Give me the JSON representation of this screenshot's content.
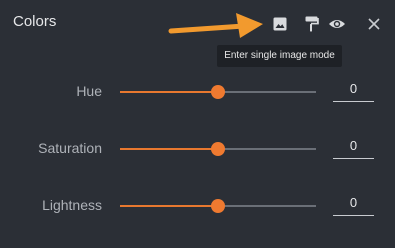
{
  "panel": {
    "title": "Colors",
    "tooltip": "Enter single image mode"
  },
  "toolbar": [
    {
      "name": "image-mode-icon"
    },
    {
      "name": "paint-roller-icon"
    },
    {
      "name": "eye-icon"
    },
    {
      "name": "close-icon"
    }
  ],
  "sliders": [
    {
      "label": "Hue",
      "value": "0",
      "position": 0.5
    },
    {
      "label": "Saturation",
      "value": "0",
      "position": 0.5
    },
    {
      "label": "Lightness",
      "value": "0",
      "position": 0.5
    }
  ],
  "colors": {
    "background": "#2b2f36",
    "accent": "#ef7a30",
    "annotation_arrow": "#f29a2e"
  }
}
